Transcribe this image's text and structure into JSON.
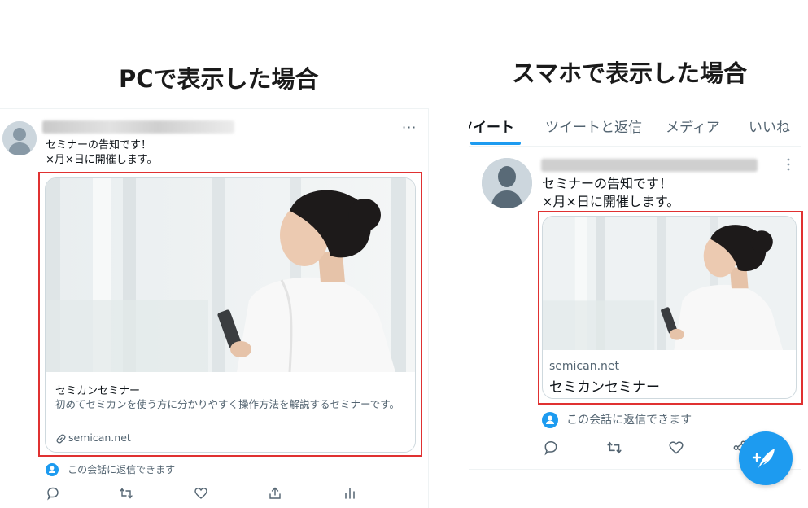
{
  "headings": {
    "pc": "PCで表示した場合",
    "phone": "スマホで表示した場合"
  },
  "colors": {
    "highlight_box": "#e03131",
    "accent": "#1d9bf0",
    "secondary_text": "#536471",
    "border": "#cfd9de"
  },
  "pc": {
    "more_icon": "more-horizontal-icon",
    "tweet_lines": [
      "セミナーの告知です！",
      "×月×日に開催します。"
    ],
    "card": {
      "title": "セミカンセミナー",
      "description": "初めてセミカンを使う方に分かりやすく操作方法を解説するセミナーです。",
      "domain": "semican.net",
      "link_icon": "link-icon"
    },
    "reply_notice": "この会話に返信できます",
    "actions": [
      "reply-icon",
      "retweet-icon",
      "like-icon",
      "share-icon",
      "analytics-icon"
    ]
  },
  "phone": {
    "tabs": [
      {
        "label": "ツイート",
        "active": true
      },
      {
        "label": "ツイートと返信",
        "active": false
      },
      {
        "label": "メディア",
        "active": false
      },
      {
        "label": "いいね",
        "active": false
      }
    ],
    "more_icon": "more-vertical-icon",
    "tweet_lines": [
      "セミナーの告知です！",
      "×月×日に開催します。"
    ],
    "card": {
      "domain": "semican.net",
      "title": "セミカンセミナー"
    },
    "reply_notice": "この会話に返信できます",
    "actions": [
      "reply-icon",
      "retweet-icon",
      "like-icon",
      "share-icon"
    ],
    "fab_icon": "compose-feather-icon"
  }
}
